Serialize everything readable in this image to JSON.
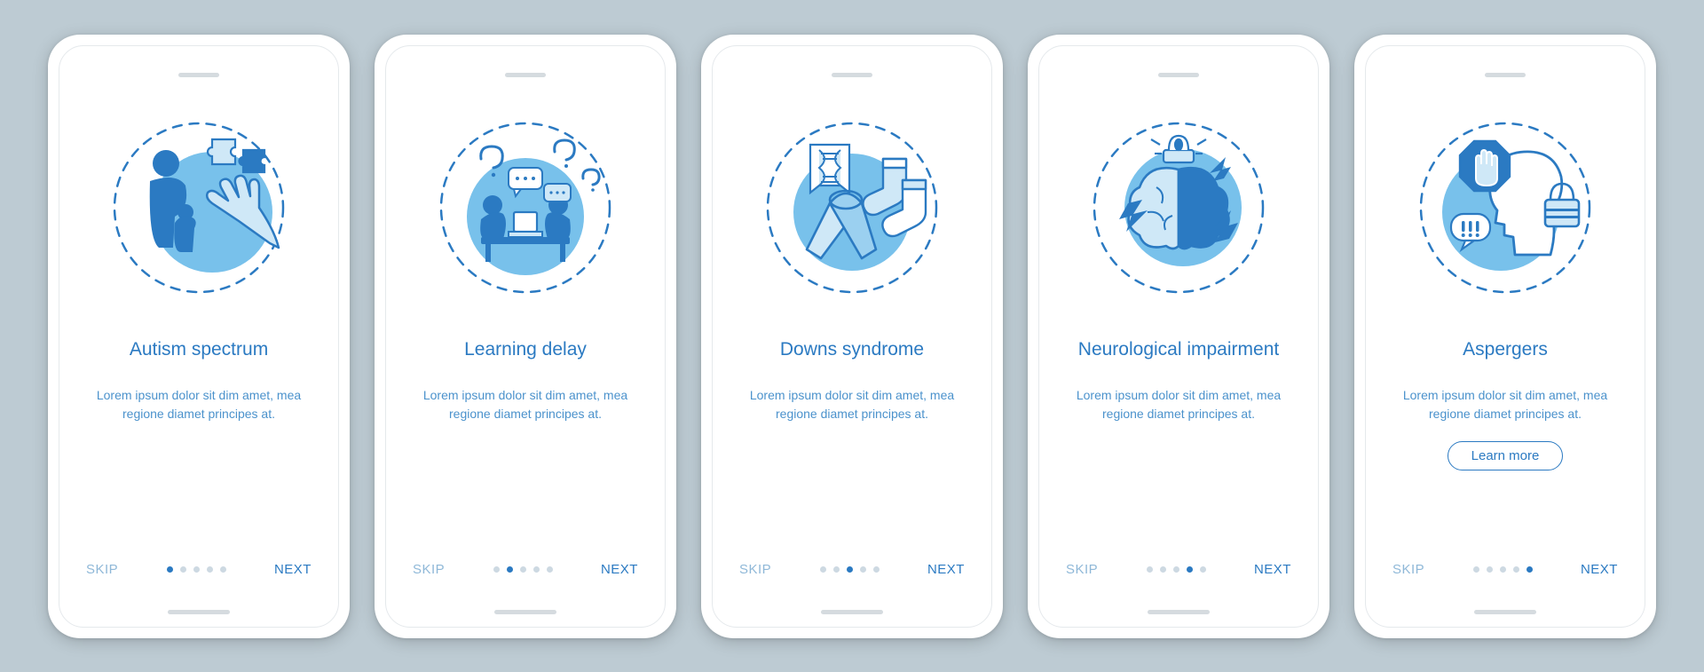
{
  "colors": {
    "accent": "#2b7ac2",
    "accentLight": "#78c1eb",
    "muted": "#8fb8d8"
  },
  "common": {
    "skip": "SKIP",
    "next": "NEXT",
    "learnMore": "Learn more",
    "lorem": "Lorem ipsum dolor sit dim amet, mea regione diamet principes at."
  },
  "screens": [
    {
      "title": "Autism spectrum",
      "icon": "autism",
      "activeDot": 0,
      "hasLearnMore": false
    },
    {
      "title": "Learning delay",
      "icon": "learning",
      "activeDot": 1,
      "hasLearnMore": false
    },
    {
      "title": "Downs syndrome",
      "icon": "downs",
      "activeDot": 2,
      "hasLearnMore": false
    },
    {
      "title": "Neurological impairment",
      "icon": "neuro",
      "activeDot": 3,
      "hasLearnMore": false
    },
    {
      "title": "Aspergers",
      "icon": "aspergers",
      "activeDot": 4,
      "hasLearnMore": true
    }
  ]
}
